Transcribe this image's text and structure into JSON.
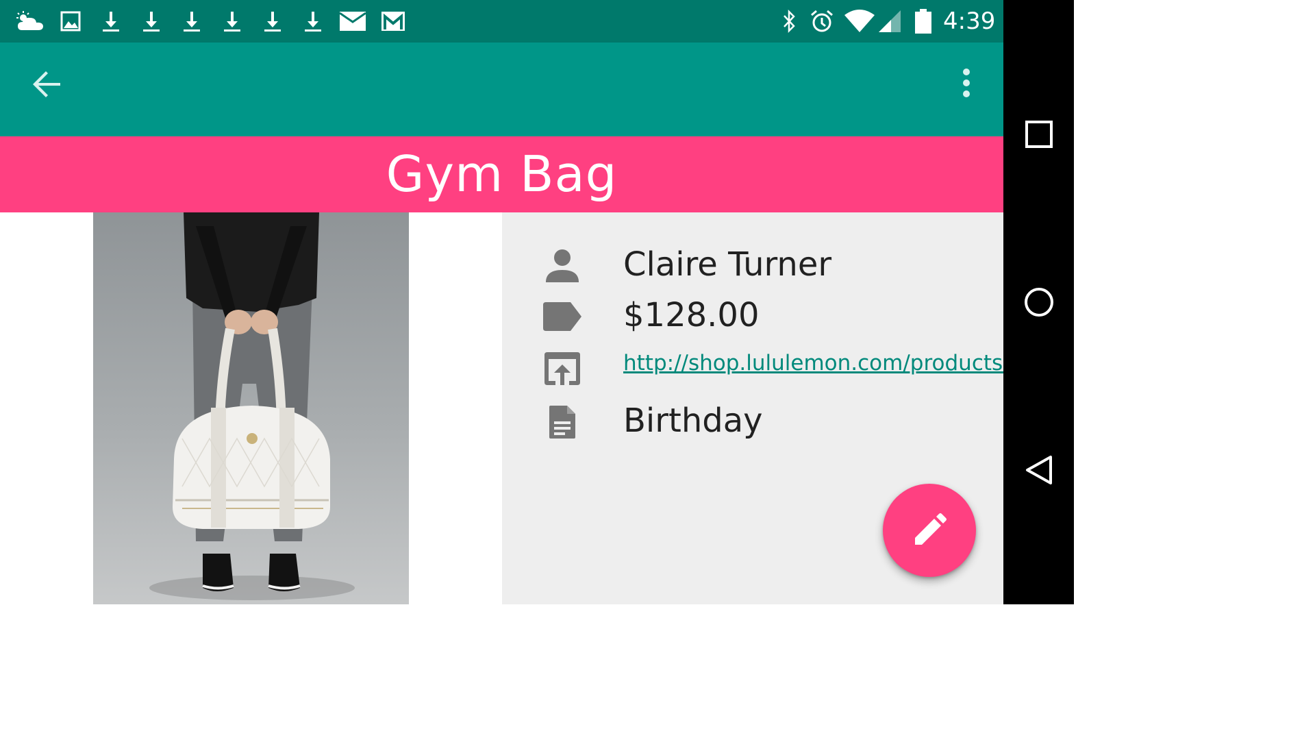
{
  "status_bar": {
    "time": "4:39",
    "left_icons": [
      "weather-cloud-icon",
      "image-icon",
      "download-icon",
      "download-icon",
      "download-icon",
      "download-icon",
      "download-icon",
      "download-icon",
      "mail-icon",
      "gmail-icon"
    ],
    "right_icons": [
      "bluetooth-icon",
      "alarm-icon",
      "wifi-icon",
      "signal-icon",
      "battery-icon"
    ]
  },
  "app_bar": {
    "back_icon": "arrow-back-icon",
    "menu_icon": "more-vert-icon"
  },
  "item": {
    "title": "Gym Bag",
    "image_description": "person holding white gym bag"
  },
  "details": {
    "name": "Claire Turner",
    "price": "$128.00",
    "link": "http://shop.lululemon.com/products…",
    "note": "Birthday"
  },
  "fab": {
    "icon": "edit-pencil-icon"
  },
  "nav_bar": {
    "icons": [
      "recents-square-icon",
      "home-circle-icon",
      "back-triangle-icon"
    ]
  },
  "colors": {
    "status_bar": "#00796b",
    "app_bar": "#009688",
    "accent": "#ff4081",
    "link": "#00897b",
    "details_bg": "#eeeeee"
  }
}
